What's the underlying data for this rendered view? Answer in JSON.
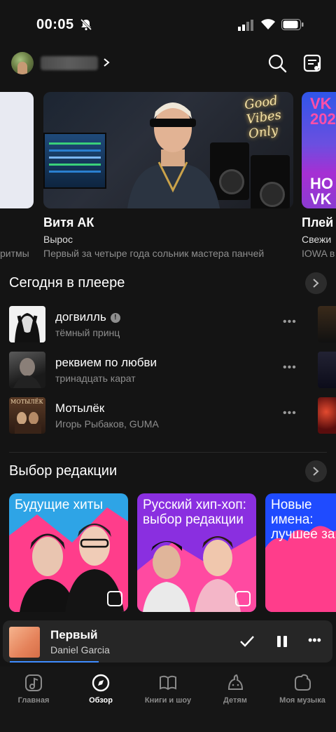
{
  "status_bar": {
    "time": "00:05"
  },
  "colors": {
    "background": "#141414",
    "accent": "#3f8cff",
    "muted": "#8e8e8e"
  },
  "header": {
    "icons": [
      "avatar",
      "chevron-right-icon",
      "search-icon",
      "queue-icon"
    ]
  },
  "featured": {
    "left_card": {
      "desc_fragment": "ритмы"
    },
    "main_card": {
      "title": "Витя АК",
      "subtitle": "Вырос",
      "description": "Первый за четыре года сольник мастера панчей",
      "neon_sign": "Good Vibes Only"
    },
    "right_card": {
      "title": "Плей",
      "subtitle": "Свежи",
      "description": "IOWA в",
      "art_text_top": "VK fe 202",
      "art_text_bottom": "HO VK"
    }
  },
  "today": {
    "title": "Сегодня в плеере",
    "tracks": [
      {
        "title": "догвилль",
        "artist": "тёмный принц",
        "explicit": true,
        "explicit_mark": "!"
      },
      {
        "title": "реквием по любви",
        "artist": "тринадцать карат",
        "explicit": false
      },
      {
        "title": "Мотылёк",
        "artist": "Игорь Рыбаков, GUMA",
        "explicit": false,
        "cover_text": "МОТЫЛЁК"
      }
    ],
    "more_label": "•••"
  },
  "editors": {
    "title": "Выбор редакции",
    "playlists": [
      {
        "title": "Будущие хиты",
        "color": "#2ea4e6"
      },
      {
        "title": "Русский хип-хоп: выбор редакции",
        "color": "#8a2fe0"
      },
      {
        "title": "Новые имена: лучшее за",
        "color": "#1f4bff"
      }
    ]
  },
  "mini_player": {
    "title": "Первый",
    "artist": "Daniel Garcia",
    "progress": 0.27,
    "more_label": "•••"
  },
  "tabs": [
    {
      "label": "Главная",
      "icon": "music-note-icon",
      "active": false
    },
    {
      "label": "Обзор",
      "icon": "compass-icon",
      "active": true
    },
    {
      "label": "Книги и шоу",
      "icon": "book-mic-icon",
      "active": false
    },
    {
      "label": "Детям",
      "icon": "kids-icon",
      "active": false
    },
    {
      "label": "Моя музыка",
      "icon": "my-music-icon",
      "active": false
    }
  ]
}
